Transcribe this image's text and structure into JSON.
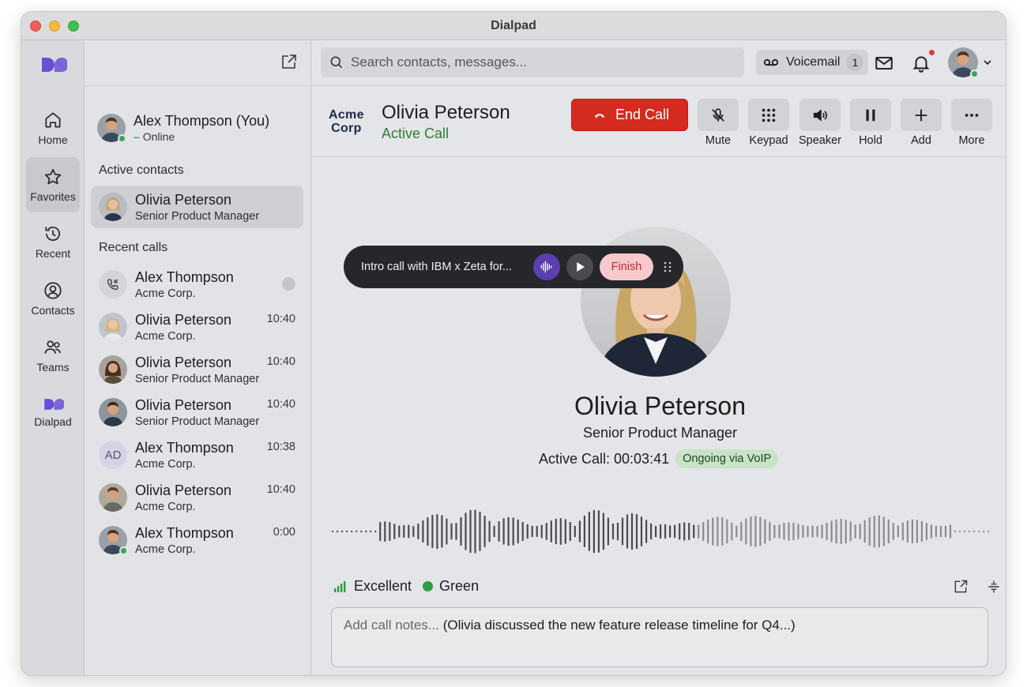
{
  "window": {
    "title": "Dialpad"
  },
  "rail": {
    "items": [
      {
        "label": "Home",
        "icon": "home-icon"
      },
      {
        "label": "Favorites",
        "icon": "star-icon"
      },
      {
        "label": "Recent",
        "icon": "history-icon"
      },
      {
        "label": "Contacts",
        "icon": "user-circle-icon"
      },
      {
        "label": "Teams",
        "icon": "team-icon"
      },
      {
        "label": "Dialpad",
        "icon": "dialpad-logo-icon"
      }
    ]
  },
  "me": {
    "name": "Alex Thompson (You)",
    "status": "Online"
  },
  "sections": {
    "active_contacts": "Active contacts",
    "recent_calls": "Recent calls"
  },
  "active_contact": {
    "name": "Olivia Peterson",
    "subtitle": "Senior Product Manager"
  },
  "recent_calls": [
    {
      "name": "Alex Thompson",
      "subtitle": "Acme Corp.",
      "time": ""
    },
    {
      "name": "Olivia Peterson",
      "subtitle": "Acme Corp.",
      "time": "10:40"
    },
    {
      "name": "Olivia Peterson",
      "subtitle": "Senior Product Manager",
      "time": "10:40"
    },
    {
      "name": "Olivia Peterson",
      "subtitle": "Senior Product Manager",
      "time": "10:40"
    },
    {
      "name": "Alex Thompson",
      "subtitle": "Acme Corp.",
      "time": "10:38",
      "initials": "AD"
    },
    {
      "name": "Olivia Peterson",
      "subtitle": "Acme Corp.",
      "time": "10:40"
    },
    {
      "name": "Alex Thompson",
      "subtitle": "Acme Corp.",
      "time": "0:00"
    }
  ],
  "search": {
    "placeholder": "Search contacts, messages..."
  },
  "voicemail": {
    "label": "Voicemail",
    "count": "1"
  },
  "call": {
    "company_line1": "Acme",
    "company_line2": "Corp",
    "name": "Olivia Peterson",
    "status": "Active Call",
    "end_call_label": "End Call",
    "controls": [
      "Mute",
      "Keypad",
      "Speaker",
      "Hold",
      "Add",
      "More"
    ],
    "title": "Senior Product Manager",
    "timer": "Active Call: 00:03:41",
    "badge": "Ongoing via VoIP"
  },
  "recorder": {
    "title": "Intro call with IBM x Zeta for...",
    "finish_label": "Finish"
  },
  "quality": {
    "signal": "Excellent",
    "indicator": "Green"
  },
  "notes": {
    "placeholder": "Add call notes...",
    "content": "(Olivia discussed the new feature release timeline for Q4...)"
  },
  "colors": {
    "accent": "#5b3fb0",
    "end_call": "#d42b1e",
    "online": "#34a853",
    "active_call": "#2e7d32"
  }
}
